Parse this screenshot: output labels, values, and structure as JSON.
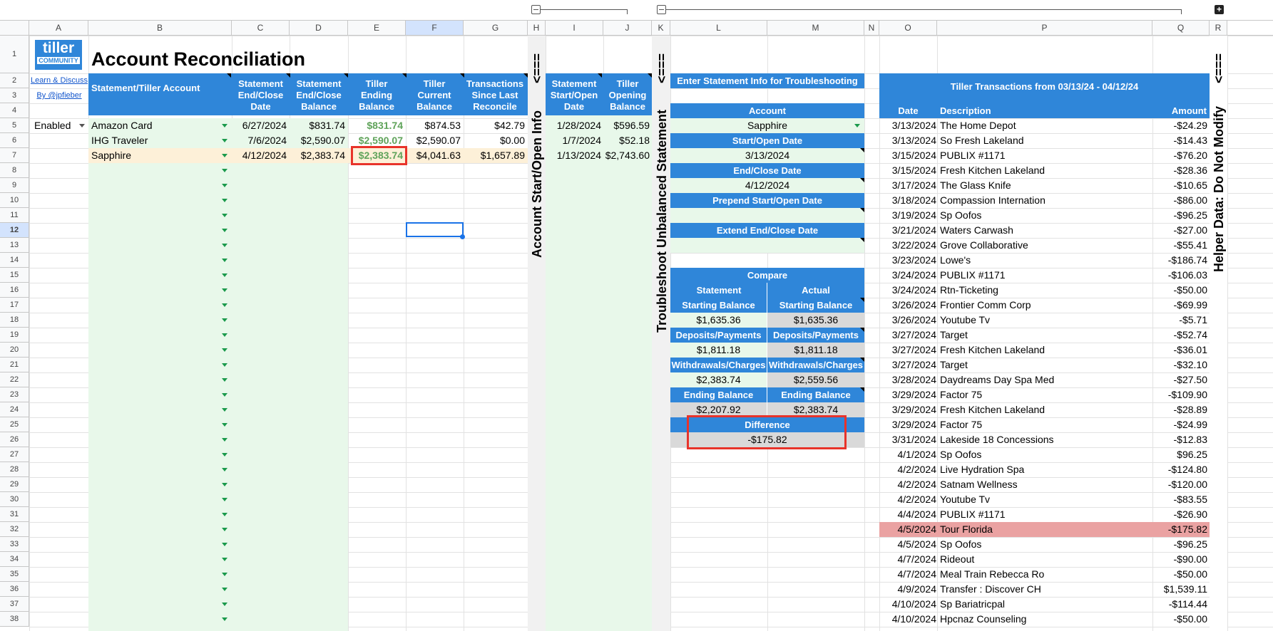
{
  "columns": [
    "A",
    "B",
    "C",
    "D",
    "E",
    "F",
    "G",
    "H",
    "I",
    "J",
    "K",
    "L",
    "M",
    "N",
    "O",
    "P",
    "Q",
    "R"
  ],
  "rows": [
    "1",
    "2",
    "3",
    "4",
    "5",
    "6",
    "7",
    "8",
    "9",
    "10",
    "11",
    "12",
    "13",
    "14",
    "15",
    "16",
    "17",
    "18",
    "19",
    "20",
    "21",
    "22",
    "23",
    "24",
    "25",
    "26",
    "27",
    "28",
    "29",
    "30",
    "31",
    "32",
    "33",
    "34",
    "35",
    "36",
    "37",
    "38"
  ],
  "logo": {
    "name": "tiller",
    "sub": "COMMUNITY"
  },
  "links": {
    "learn": "Learn & Discuss",
    "by": "By @jpfieber"
  },
  "status": {
    "value": "Enabled"
  },
  "title": "Account Reconciliation",
  "main_table": {
    "headers": [
      "Statement/Tiller Account",
      "Statement End/Close Date",
      "Statement End/Close Balance",
      "Tiller Ending Balance",
      "Tiller Current Balance",
      "Transactions Since Last Reconcile"
    ],
    "rows": [
      {
        "account": "Amazon Card",
        "end_date": "6/27/2024",
        "end_balance": "$831.74",
        "tiller_ending": "$831.74",
        "tiller_current": "$874.53",
        "since": "$42.79"
      },
      {
        "account": "IHG Traveler",
        "end_date": "7/6/2024",
        "end_balance": "$2,590.07",
        "tiller_ending": "$2,590.07",
        "tiller_current": "$2,590.07",
        "since": "$0.00"
      },
      {
        "account": "Sapphire",
        "end_date": "4/12/2024",
        "end_balance": "$2,383.74",
        "tiller_ending": "$2,383.74",
        "tiller_current": "$4,041.63",
        "since": "$1,657.89"
      }
    ]
  },
  "start_table": {
    "headers": [
      "Statement Start/Open Date",
      "Tiller Opening Balance"
    ],
    "rows": [
      {
        "date": "1/28/2024",
        "balance": "$596.59"
      },
      {
        "date": "1/7/2024",
        "balance": "$52.18"
      },
      {
        "date": "1/13/2024",
        "balance": "$2,743.60"
      }
    ]
  },
  "vertical_labels": {
    "h": "Account Start/Open Info",
    "h_arrow": "<===",
    "k": "Troubleshoot Unbalanced Statement",
    "k_arrow": "<===",
    "r": "Helper Data: Do Not Modify",
    "r_arrow": "<==="
  },
  "troubleshoot": {
    "enter_label": "Enter Statement Info for Troubleshooting",
    "account_label": "Account",
    "account_value": "Sapphire",
    "start_label": "Start/Open Date",
    "start_value": "3/13/2024",
    "end_label": "End/Close Date",
    "end_value": "4/12/2024",
    "prepend_label": "Prepend Start/Open Date",
    "prepend_value": "",
    "extend_label": "Extend End/Close Date",
    "extend_value": ""
  },
  "compare": {
    "title": "Compare",
    "col_statement": "Statement",
    "col_actual": "Actual",
    "rows": [
      {
        "label": "Starting Balance",
        "statement": "$1,635.36",
        "actual": "$1,635.36"
      },
      {
        "label": "Deposits/Payments",
        "statement": "$1,811.18",
        "actual": "$1,811.18"
      },
      {
        "label": "Withdrawals/Charges",
        "statement": "$2,383.74",
        "actual": "$2,559.56"
      },
      {
        "label": "Ending Balance",
        "statement": "$2,207.92",
        "actual": "$2,383.74"
      }
    ],
    "difference_label": "Difference",
    "difference_value": "-$175.82"
  },
  "transactions": {
    "title": "Tiller Transactions from 03/13/24 - 04/12/24",
    "headers": [
      "Date",
      "Description",
      "Amount"
    ],
    "rows": [
      {
        "date": "3/13/2024",
        "desc": "The Home Depot",
        "amount": "-$24.29"
      },
      {
        "date": "3/13/2024",
        "desc": "So Fresh Lakeland",
        "amount": "-$14.43"
      },
      {
        "date": "3/15/2024",
        "desc": "PUBLIX #1171",
        "amount": "-$76.20"
      },
      {
        "date": "3/15/2024",
        "desc": "Fresh Kitchen Lakeland",
        "amount": "-$28.36"
      },
      {
        "date": "3/17/2024",
        "desc": "The Glass Knife",
        "amount": "-$10.65"
      },
      {
        "date": "3/18/2024",
        "desc": "Compassion Internation",
        "amount": "-$86.00"
      },
      {
        "date": "3/19/2024",
        "desc": "Sp Oofos",
        "amount": "-$96.25"
      },
      {
        "date": "3/21/2024",
        "desc": "Waters Carwash",
        "amount": "-$27.00"
      },
      {
        "date": "3/22/2024",
        "desc": "Grove Collaborative",
        "amount": "-$55.41"
      },
      {
        "date": "3/23/2024",
        "desc": "Lowe's",
        "amount": "-$186.74"
      },
      {
        "date": "3/24/2024",
        "desc": "PUBLIX #1171",
        "amount": "-$106.03"
      },
      {
        "date": "3/24/2024",
        "desc": "Rtn-Ticketing",
        "amount": "-$50.00"
      },
      {
        "date": "3/26/2024",
        "desc": "Frontier Comm Corp",
        "amount": "-$69.99"
      },
      {
        "date": "3/26/2024",
        "desc": "Youtube Tv",
        "amount": "-$5.71"
      },
      {
        "date": "3/27/2024",
        "desc": "Target",
        "amount": "-$52.74"
      },
      {
        "date": "3/27/2024",
        "desc": "Fresh Kitchen Lakeland",
        "amount": "-$36.01"
      },
      {
        "date": "3/27/2024",
        "desc": "Target",
        "amount": "-$32.10"
      },
      {
        "date": "3/28/2024",
        "desc": "Daydreams Day Spa Med",
        "amount": "-$27.50"
      },
      {
        "date": "3/29/2024",
        "desc": "Factor 75",
        "amount": "-$109.90"
      },
      {
        "date": "3/29/2024",
        "desc": "Fresh Kitchen Lakeland",
        "amount": "-$28.89"
      },
      {
        "date": "3/29/2024",
        "desc": "Factor 75",
        "amount": "-$24.99"
      },
      {
        "date": "3/31/2024",
        "desc": "Lakeside 18 Concessions",
        "amount": "-$12.83"
      },
      {
        "date": "4/1/2024",
        "desc": "Sp Oofos",
        "amount": "$96.25"
      },
      {
        "date": "4/2/2024",
        "desc": "Live Hydration Spa",
        "amount": "-$124.80"
      },
      {
        "date": "4/2/2024",
        "desc": "Satnam Wellness",
        "amount": "-$120.00"
      },
      {
        "date": "4/2/2024",
        "desc": "Youtube Tv",
        "amount": "-$83.55"
      },
      {
        "date": "4/4/2024",
        "desc": "PUBLIX #1171",
        "amount": "-$26.90"
      },
      {
        "date": "4/5/2024",
        "desc": "Tour Florida",
        "amount": "-$175.82"
      },
      {
        "date": "4/5/2024",
        "desc": "Sp Oofos",
        "amount": "-$96.25"
      },
      {
        "date": "4/7/2024",
        "desc": "Rideout",
        "amount": "-$90.00"
      },
      {
        "date": "4/7/2024",
        "desc": "Meal Train Rebecca Ro",
        "amount": "-$50.00"
      },
      {
        "date": "4/9/2024",
        "desc": "Transfer : Discover CH",
        "amount": "$1,539.11"
      },
      {
        "date": "4/10/2024",
        "desc": "Sp Bariatricpal",
        "amount": "-$114.44"
      },
      {
        "date": "4/10/2024",
        "desc": "Hpcnaz Counseling",
        "amount": "-$50.00"
      }
    ],
    "highlight_index": 27
  },
  "colors": {
    "header_blue": "#2f86d9",
    "light_green": "#e8f8ea",
    "highlight_orange": "#fdf0d8",
    "positive_green": "#5fa35a",
    "highlight_red": "#eaa2a2",
    "red_border": "#e8332a",
    "gray_cell": "#d9d9d9"
  }
}
